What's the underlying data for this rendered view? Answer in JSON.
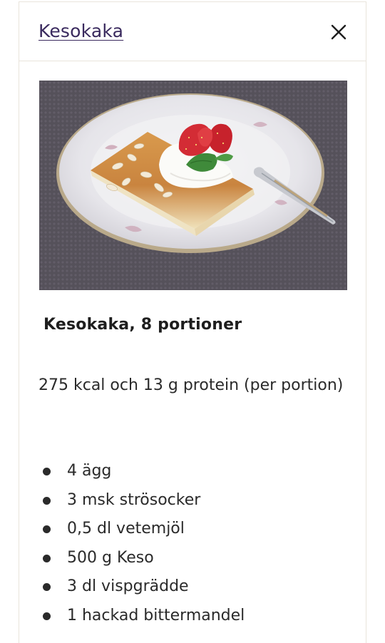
{
  "header": {
    "title": "Kesokaka"
  },
  "icons": {
    "close": "close-icon"
  },
  "recipe": {
    "heading": "Kesokaka, 8 portioner",
    "nutrition": "275 kcal och 13 g protein (per portion)",
    "ingredients": [
      "4 ägg",
      "3 msk strösocker",
      "0,5 dl vetemjöl",
      "500 g Keso",
      "3 dl vispgrädde",
      "1 hackad bittermandel"
    ]
  },
  "colors": {
    "title_link": "#3a2a5e",
    "text": "#1e1e1e",
    "divider": "#e9e4dc"
  }
}
